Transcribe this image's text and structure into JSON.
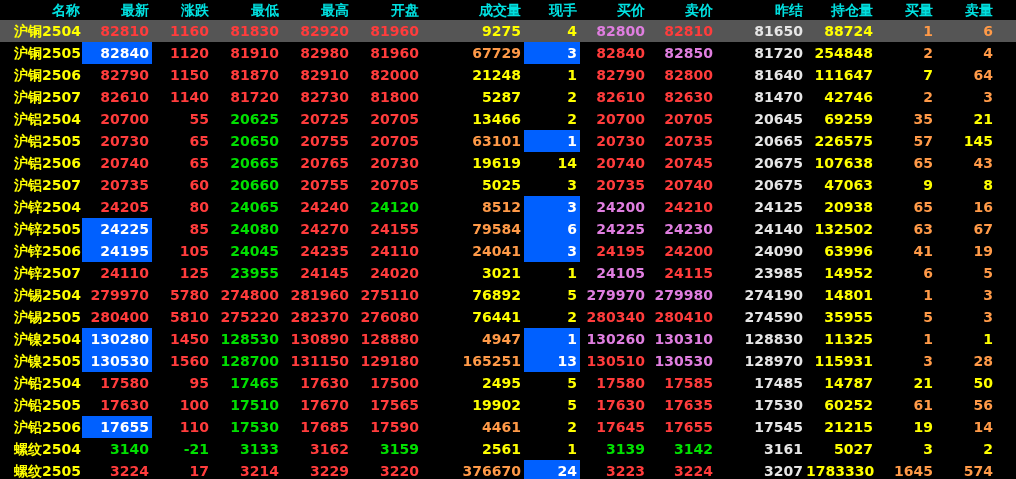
{
  "table": {
    "columns": [
      "名称",
      "最新",
      "涨跌",
      "最低",
      "最高",
      "开盘",
      "成交量",
      "现手",
      "买价",
      "卖价",
      "昨结",
      "持仓量",
      "买量",
      "卖量"
    ],
    "rows": [
      {
        "selected": true,
        "latest_flash": false,
        "hand_flash": false,
        "cells": [
          {
            "text": "沪铜2504",
            "color": "#ffff00"
          },
          {
            "text": "82810",
            "color": "#ff3c3c"
          },
          {
            "text": "1160",
            "color": "#ff3c3c"
          },
          {
            "text": "81830",
            "color": "#ff3c3c"
          },
          {
            "text": "82920",
            "color": "#ff3c3c"
          },
          {
            "text": "81960",
            "color": "#ff3c3c"
          },
          {
            "text": "9275",
            "color": "#ffff00"
          },
          {
            "text": "4",
            "color": "#ffff00"
          },
          {
            "text": "82800",
            "color": "#e07ee0"
          },
          {
            "text": "82810",
            "color": "#ff3c3c"
          },
          {
            "text": "81650",
            "color": "#e6e6e6"
          },
          {
            "text": "88724",
            "color": "#ffff00"
          },
          {
            "text": "1",
            "color": "#ff9a48"
          },
          {
            "text": "6",
            "color": "#ff9a48"
          }
        ]
      },
      {
        "selected": false,
        "latest_flash": true,
        "hand_flash": true,
        "cells": [
          {
            "text": "沪铜2505",
            "color": "#ffff00"
          },
          {
            "text": "82840",
            "color": "#ffffff"
          },
          {
            "text": "1120",
            "color": "#ff3c3c"
          },
          {
            "text": "81910",
            "color": "#ff3c3c"
          },
          {
            "text": "82980",
            "color": "#ff3c3c"
          },
          {
            "text": "81960",
            "color": "#ff3c3c"
          },
          {
            "text": "67729",
            "color": "#ff9a48"
          },
          {
            "text": "3",
            "color": "#ffffff"
          },
          {
            "text": "82840",
            "color": "#ff3c3c"
          },
          {
            "text": "82850",
            "color": "#e07ee0"
          },
          {
            "text": "81720",
            "color": "#e6e6e6"
          },
          {
            "text": "254848",
            "color": "#ffff00"
          },
          {
            "text": "2",
            "color": "#ff9a48"
          },
          {
            "text": "4",
            "color": "#ff9a48"
          }
        ]
      },
      {
        "selected": false,
        "latest_flash": false,
        "hand_flash": false,
        "cells": [
          {
            "text": "沪铜2506",
            "color": "#ffff00"
          },
          {
            "text": "82790",
            "color": "#ff3c3c"
          },
          {
            "text": "1150",
            "color": "#ff3c3c"
          },
          {
            "text": "81870",
            "color": "#ff3c3c"
          },
          {
            "text": "82910",
            "color": "#ff3c3c"
          },
          {
            "text": "82000",
            "color": "#ff3c3c"
          },
          {
            "text": "21248",
            "color": "#ffff00"
          },
          {
            "text": "1",
            "color": "#ffff00"
          },
          {
            "text": "82790",
            "color": "#ff3c3c"
          },
          {
            "text": "82800",
            "color": "#ff3c3c"
          },
          {
            "text": "81640",
            "color": "#e6e6e6"
          },
          {
            "text": "111647",
            "color": "#ffff00"
          },
          {
            "text": "7",
            "color": "#ffff00"
          },
          {
            "text": "64",
            "color": "#ff9a48"
          }
        ]
      },
      {
        "selected": false,
        "latest_flash": false,
        "hand_flash": false,
        "cells": [
          {
            "text": "沪铜2507",
            "color": "#ffff00"
          },
          {
            "text": "82610",
            "color": "#ff3c3c"
          },
          {
            "text": "1140",
            "color": "#ff3c3c"
          },
          {
            "text": "81720",
            "color": "#ff3c3c"
          },
          {
            "text": "82730",
            "color": "#ff3c3c"
          },
          {
            "text": "81800",
            "color": "#ff3c3c"
          },
          {
            "text": "5287",
            "color": "#ffff00"
          },
          {
            "text": "2",
            "color": "#ffff00"
          },
          {
            "text": "82610",
            "color": "#ff3c3c"
          },
          {
            "text": "82630",
            "color": "#ff3c3c"
          },
          {
            "text": "81470",
            "color": "#e6e6e6"
          },
          {
            "text": "42746",
            "color": "#ffff00"
          },
          {
            "text": "2",
            "color": "#ff9a48"
          },
          {
            "text": "3",
            "color": "#ff9a48"
          }
        ]
      },
      {
        "selected": false,
        "latest_flash": false,
        "hand_flash": false,
        "cells": [
          {
            "text": "沪铝2504",
            "color": "#ffff00"
          },
          {
            "text": "20700",
            "color": "#ff3c3c"
          },
          {
            "text": "55",
            "color": "#ff3c3c"
          },
          {
            "text": "20625",
            "color": "#00e000"
          },
          {
            "text": "20725",
            "color": "#ff3c3c"
          },
          {
            "text": "20705",
            "color": "#ff3c3c"
          },
          {
            "text": "13466",
            "color": "#ffff00"
          },
          {
            "text": "2",
            "color": "#ffff00"
          },
          {
            "text": "20700",
            "color": "#ff3c3c"
          },
          {
            "text": "20705",
            "color": "#ff3c3c"
          },
          {
            "text": "20645",
            "color": "#e6e6e6"
          },
          {
            "text": "69259",
            "color": "#ffff00"
          },
          {
            "text": "35",
            "color": "#ff9a48"
          },
          {
            "text": "21",
            "color": "#ffff00"
          }
        ]
      },
      {
        "selected": false,
        "latest_flash": false,
        "hand_flash": true,
        "cells": [
          {
            "text": "沪铝2505",
            "color": "#ffff00"
          },
          {
            "text": "20730",
            "color": "#ff3c3c"
          },
          {
            "text": "65",
            "color": "#ff3c3c"
          },
          {
            "text": "20650",
            "color": "#00e000"
          },
          {
            "text": "20755",
            "color": "#ff3c3c"
          },
          {
            "text": "20705",
            "color": "#ff3c3c"
          },
          {
            "text": "63101",
            "color": "#ff9a48"
          },
          {
            "text": "1",
            "color": "#ffffff"
          },
          {
            "text": "20730",
            "color": "#ff3c3c"
          },
          {
            "text": "20735",
            "color": "#ff3c3c"
          },
          {
            "text": "20665",
            "color": "#e6e6e6"
          },
          {
            "text": "226575",
            "color": "#ffff00"
          },
          {
            "text": "57",
            "color": "#ff9a48"
          },
          {
            "text": "145",
            "color": "#ffff00"
          }
        ]
      },
      {
        "selected": false,
        "latest_flash": false,
        "hand_flash": false,
        "cells": [
          {
            "text": "沪铝2506",
            "color": "#ffff00"
          },
          {
            "text": "20740",
            "color": "#ff3c3c"
          },
          {
            "text": "65",
            "color": "#ff3c3c"
          },
          {
            "text": "20665",
            "color": "#00e000"
          },
          {
            "text": "20765",
            "color": "#ff3c3c"
          },
          {
            "text": "20730",
            "color": "#ff3c3c"
          },
          {
            "text": "19619",
            "color": "#ffff00"
          },
          {
            "text": "14",
            "color": "#ffff00"
          },
          {
            "text": "20740",
            "color": "#ff3c3c"
          },
          {
            "text": "20745",
            "color": "#ff3c3c"
          },
          {
            "text": "20675",
            "color": "#e6e6e6"
          },
          {
            "text": "107638",
            "color": "#ffff00"
          },
          {
            "text": "65",
            "color": "#ff9a48"
          },
          {
            "text": "43",
            "color": "#ff9a48"
          }
        ]
      },
      {
        "selected": false,
        "latest_flash": false,
        "hand_flash": false,
        "cells": [
          {
            "text": "沪铝2507",
            "color": "#ffff00"
          },
          {
            "text": "20735",
            "color": "#ff3c3c"
          },
          {
            "text": "60",
            "color": "#ff3c3c"
          },
          {
            "text": "20660",
            "color": "#00e000"
          },
          {
            "text": "20755",
            "color": "#ff3c3c"
          },
          {
            "text": "20705",
            "color": "#ff3c3c"
          },
          {
            "text": "5025",
            "color": "#ffff00"
          },
          {
            "text": "3",
            "color": "#ffff00"
          },
          {
            "text": "20735",
            "color": "#ff3c3c"
          },
          {
            "text": "20740",
            "color": "#ff3c3c"
          },
          {
            "text": "20675",
            "color": "#e6e6e6"
          },
          {
            "text": "47063",
            "color": "#ffff00"
          },
          {
            "text": "9",
            "color": "#ffff00"
          },
          {
            "text": "8",
            "color": "#ffff00"
          }
        ]
      },
      {
        "selected": false,
        "latest_flash": false,
        "hand_flash": true,
        "cells": [
          {
            "text": "沪锌2504",
            "color": "#ffff00"
          },
          {
            "text": "24205",
            "color": "#ff3c3c"
          },
          {
            "text": "80",
            "color": "#ff3c3c"
          },
          {
            "text": "24065",
            "color": "#00e000"
          },
          {
            "text": "24240",
            "color": "#ff3c3c"
          },
          {
            "text": "24120",
            "color": "#00e000"
          },
          {
            "text": "8512",
            "color": "#ff9a48"
          },
          {
            "text": "3",
            "color": "#ffffff"
          },
          {
            "text": "24200",
            "color": "#e07ee0"
          },
          {
            "text": "24210",
            "color": "#ff3c3c"
          },
          {
            "text": "24125",
            "color": "#e6e6e6"
          },
          {
            "text": "20938",
            "color": "#ffff00"
          },
          {
            "text": "65",
            "color": "#ff9a48"
          },
          {
            "text": "16",
            "color": "#ff9a48"
          }
        ]
      },
      {
        "selected": false,
        "latest_flash": true,
        "hand_flash": true,
        "cells": [
          {
            "text": "沪锌2505",
            "color": "#ffff00"
          },
          {
            "text": "24225",
            "color": "#ffffff"
          },
          {
            "text": "85",
            "color": "#ff3c3c"
          },
          {
            "text": "24080",
            "color": "#00e000"
          },
          {
            "text": "24270",
            "color": "#ff3c3c"
          },
          {
            "text": "24155",
            "color": "#ff3c3c"
          },
          {
            "text": "79584",
            "color": "#ff9a48"
          },
          {
            "text": "6",
            "color": "#ffffff"
          },
          {
            "text": "24225",
            "color": "#e07ee0"
          },
          {
            "text": "24230",
            "color": "#e07ee0"
          },
          {
            "text": "24140",
            "color": "#e6e6e6"
          },
          {
            "text": "132502",
            "color": "#ffff00"
          },
          {
            "text": "63",
            "color": "#ff9a48"
          },
          {
            "text": "67",
            "color": "#ff9a48"
          }
        ]
      },
      {
        "selected": false,
        "latest_flash": true,
        "hand_flash": true,
        "cells": [
          {
            "text": "沪锌2506",
            "color": "#ffff00"
          },
          {
            "text": "24195",
            "color": "#ffffff"
          },
          {
            "text": "105",
            "color": "#ff3c3c"
          },
          {
            "text": "24045",
            "color": "#00e000"
          },
          {
            "text": "24235",
            "color": "#ff3c3c"
          },
          {
            "text": "24110",
            "color": "#ff3c3c"
          },
          {
            "text": "24041",
            "color": "#ff9a48"
          },
          {
            "text": "3",
            "color": "#ffffff"
          },
          {
            "text": "24195",
            "color": "#ff3c3c"
          },
          {
            "text": "24200",
            "color": "#ff3c3c"
          },
          {
            "text": "24090",
            "color": "#e6e6e6"
          },
          {
            "text": "63996",
            "color": "#ffff00"
          },
          {
            "text": "41",
            "color": "#ff9a48"
          },
          {
            "text": "19",
            "color": "#ff9a48"
          }
        ]
      },
      {
        "selected": false,
        "latest_flash": false,
        "hand_flash": false,
        "cells": [
          {
            "text": "沪锌2507",
            "color": "#ffff00"
          },
          {
            "text": "24110",
            "color": "#ff3c3c"
          },
          {
            "text": "125",
            "color": "#ff3c3c"
          },
          {
            "text": "23955",
            "color": "#00e000"
          },
          {
            "text": "24145",
            "color": "#ff3c3c"
          },
          {
            "text": "24020",
            "color": "#ff3c3c"
          },
          {
            "text": "3021",
            "color": "#ffff00"
          },
          {
            "text": "1",
            "color": "#ffff00"
          },
          {
            "text": "24105",
            "color": "#e07ee0"
          },
          {
            "text": "24115",
            "color": "#ff3c3c"
          },
          {
            "text": "23985",
            "color": "#e6e6e6"
          },
          {
            "text": "14952",
            "color": "#ffff00"
          },
          {
            "text": "6",
            "color": "#ff9a48"
          },
          {
            "text": "5",
            "color": "#ff9a48"
          }
        ]
      },
      {
        "selected": false,
        "latest_flash": false,
        "hand_flash": false,
        "cells": [
          {
            "text": "沪锡2504",
            "color": "#ffff00"
          },
          {
            "text": "279970",
            "color": "#ff3c3c"
          },
          {
            "text": "5780",
            "color": "#ff3c3c"
          },
          {
            "text": "274800",
            "color": "#ff3c3c"
          },
          {
            "text": "281960",
            "color": "#ff3c3c"
          },
          {
            "text": "275110",
            "color": "#ff3c3c"
          },
          {
            "text": "76892",
            "color": "#ffff00"
          },
          {
            "text": "5",
            "color": "#ffff00"
          },
          {
            "text": "279970",
            "color": "#e07ee0"
          },
          {
            "text": "279980",
            "color": "#e07ee0"
          },
          {
            "text": "274190",
            "color": "#e6e6e6"
          },
          {
            "text": "14801",
            "color": "#ffff00"
          },
          {
            "text": "1",
            "color": "#ff9a48"
          },
          {
            "text": "3",
            "color": "#ff9a48"
          }
        ]
      },
      {
        "selected": false,
        "latest_flash": false,
        "hand_flash": false,
        "cells": [
          {
            "text": "沪锡2505",
            "color": "#ffff00"
          },
          {
            "text": "280400",
            "color": "#ff3c3c"
          },
          {
            "text": "5810",
            "color": "#ff3c3c"
          },
          {
            "text": "275220",
            "color": "#ff3c3c"
          },
          {
            "text": "282370",
            "color": "#ff3c3c"
          },
          {
            "text": "276080",
            "color": "#ff3c3c"
          },
          {
            "text": "76441",
            "color": "#ffff00"
          },
          {
            "text": "2",
            "color": "#ffff00"
          },
          {
            "text": "280340",
            "color": "#ff3c3c"
          },
          {
            "text": "280410",
            "color": "#ff3c3c"
          },
          {
            "text": "274590",
            "color": "#e6e6e6"
          },
          {
            "text": "35955",
            "color": "#ffff00"
          },
          {
            "text": "5",
            "color": "#ff9a48"
          },
          {
            "text": "3",
            "color": "#ff9a48"
          }
        ]
      },
      {
        "selected": false,
        "latest_flash": true,
        "hand_flash": true,
        "cells": [
          {
            "text": "沪镍2504",
            "color": "#ffff00"
          },
          {
            "text": "130280",
            "color": "#ffffff"
          },
          {
            "text": "1450",
            "color": "#ff3c3c"
          },
          {
            "text": "128530",
            "color": "#00e000"
          },
          {
            "text": "130890",
            "color": "#ff3c3c"
          },
          {
            "text": "128880",
            "color": "#ff3c3c"
          },
          {
            "text": "4947",
            "color": "#ff9a48"
          },
          {
            "text": "1",
            "color": "#ffffff"
          },
          {
            "text": "130260",
            "color": "#e07ee0"
          },
          {
            "text": "130310",
            "color": "#e07ee0"
          },
          {
            "text": "128830",
            "color": "#e6e6e6"
          },
          {
            "text": "11325",
            "color": "#ffff00"
          },
          {
            "text": "1",
            "color": "#ff9a48"
          },
          {
            "text": "1",
            "color": "#ffff00"
          }
        ]
      },
      {
        "selected": false,
        "latest_flash": true,
        "hand_flash": true,
        "cells": [
          {
            "text": "沪镍2505",
            "color": "#ffff00"
          },
          {
            "text": "130530",
            "color": "#ffffff"
          },
          {
            "text": "1560",
            "color": "#ff3c3c"
          },
          {
            "text": "128700",
            "color": "#00e000"
          },
          {
            "text": "131150",
            "color": "#ff3c3c"
          },
          {
            "text": "129180",
            "color": "#ff3c3c"
          },
          {
            "text": "165251",
            "color": "#ff9a48"
          },
          {
            "text": "13",
            "color": "#ffffff"
          },
          {
            "text": "130510",
            "color": "#ff3c3c"
          },
          {
            "text": "130530",
            "color": "#e07ee0"
          },
          {
            "text": "128970",
            "color": "#e6e6e6"
          },
          {
            "text": "115931",
            "color": "#ffff00"
          },
          {
            "text": "3",
            "color": "#ff9a48"
          },
          {
            "text": "28",
            "color": "#ff9a48"
          }
        ]
      },
      {
        "selected": false,
        "latest_flash": false,
        "hand_flash": false,
        "cells": [
          {
            "text": "沪铅2504",
            "color": "#ffff00"
          },
          {
            "text": "17580",
            "color": "#ff3c3c"
          },
          {
            "text": "95",
            "color": "#ff3c3c"
          },
          {
            "text": "17465",
            "color": "#00e000"
          },
          {
            "text": "17630",
            "color": "#ff3c3c"
          },
          {
            "text": "17500",
            "color": "#ff3c3c"
          },
          {
            "text": "2495",
            "color": "#ffff00"
          },
          {
            "text": "5",
            "color": "#ffff00"
          },
          {
            "text": "17580",
            "color": "#ff3c3c"
          },
          {
            "text": "17585",
            "color": "#ff3c3c"
          },
          {
            "text": "17485",
            "color": "#e6e6e6"
          },
          {
            "text": "14787",
            "color": "#ffff00"
          },
          {
            "text": "21",
            "color": "#ffff00"
          },
          {
            "text": "50",
            "color": "#ffff00"
          }
        ]
      },
      {
        "selected": false,
        "latest_flash": false,
        "hand_flash": false,
        "cells": [
          {
            "text": "沪铅2505",
            "color": "#ffff00"
          },
          {
            "text": "17630",
            "color": "#ff3c3c"
          },
          {
            "text": "100",
            "color": "#ff3c3c"
          },
          {
            "text": "17510",
            "color": "#00e000"
          },
          {
            "text": "17670",
            "color": "#ff3c3c"
          },
          {
            "text": "17565",
            "color": "#ff3c3c"
          },
          {
            "text": "19902",
            "color": "#ffff00"
          },
          {
            "text": "5",
            "color": "#ffff00"
          },
          {
            "text": "17630",
            "color": "#ff3c3c"
          },
          {
            "text": "17635",
            "color": "#ff3c3c"
          },
          {
            "text": "17530",
            "color": "#e6e6e6"
          },
          {
            "text": "60252",
            "color": "#ffff00"
          },
          {
            "text": "61",
            "color": "#ff9a48"
          },
          {
            "text": "56",
            "color": "#ff9a48"
          }
        ]
      },
      {
        "selected": false,
        "latest_flash": true,
        "hand_flash": false,
        "cells": [
          {
            "text": "沪铅2506",
            "color": "#ffff00"
          },
          {
            "text": "17655",
            "color": "#ffffff"
          },
          {
            "text": "110",
            "color": "#ff3c3c"
          },
          {
            "text": "17530",
            "color": "#00e000"
          },
          {
            "text": "17685",
            "color": "#ff3c3c"
          },
          {
            "text": "17590",
            "color": "#ff3c3c"
          },
          {
            "text": "4461",
            "color": "#ff9a48"
          },
          {
            "text": "2",
            "color": "#ffff00"
          },
          {
            "text": "17645",
            "color": "#ff3c3c"
          },
          {
            "text": "17655",
            "color": "#ff3c3c"
          },
          {
            "text": "17545",
            "color": "#e6e6e6"
          },
          {
            "text": "21215",
            "color": "#ffff00"
          },
          {
            "text": "19",
            "color": "#ffff00"
          },
          {
            "text": "14",
            "color": "#ff9a48"
          }
        ]
      },
      {
        "selected": false,
        "latest_flash": false,
        "hand_flash": false,
        "cells": [
          {
            "text": "螺纹2504",
            "color": "#ffff00"
          },
          {
            "text": "3140",
            "color": "#00e000"
          },
          {
            "text": "-21",
            "color": "#00e000"
          },
          {
            "text": "3133",
            "color": "#00e000"
          },
          {
            "text": "3162",
            "color": "#ff3c3c"
          },
          {
            "text": "3159",
            "color": "#00e000"
          },
          {
            "text": "2561",
            "color": "#ffff00"
          },
          {
            "text": "1",
            "color": "#ffff00"
          },
          {
            "text": "3139",
            "color": "#00e000"
          },
          {
            "text": "3142",
            "color": "#00e000"
          },
          {
            "text": "3161",
            "color": "#e6e6e6"
          },
          {
            "text": "5027",
            "color": "#ffff00"
          },
          {
            "text": "3",
            "color": "#ffff00"
          },
          {
            "text": "2",
            "color": "#ffff00"
          }
        ]
      },
      {
        "selected": false,
        "latest_flash": false,
        "hand_flash": true,
        "cells": [
          {
            "text": "螺纹2505",
            "color": "#ffff00"
          },
          {
            "text": "3224",
            "color": "#ff3c3c"
          },
          {
            "text": "17",
            "color": "#ff3c3c"
          },
          {
            "text": "3214",
            "color": "#ff3c3c"
          },
          {
            "text": "3229",
            "color": "#ff3c3c"
          },
          {
            "text": "3220",
            "color": "#ff3c3c"
          },
          {
            "text": "376670",
            "color": "#ff9a48"
          },
          {
            "text": "24",
            "color": "#ffffff"
          },
          {
            "text": "3223",
            "color": "#ff3c3c"
          },
          {
            "text": "3224",
            "color": "#ff3c3c"
          },
          {
            "text": "3207",
            "color": "#e6e6e6"
          },
          {
            "text": "1783330",
            "color": "#ffff00"
          },
          {
            "text": "1645",
            "color": "#ff9a48"
          },
          {
            "text": "574",
            "color": "#ff9a48"
          }
        ]
      }
    ]
  }
}
